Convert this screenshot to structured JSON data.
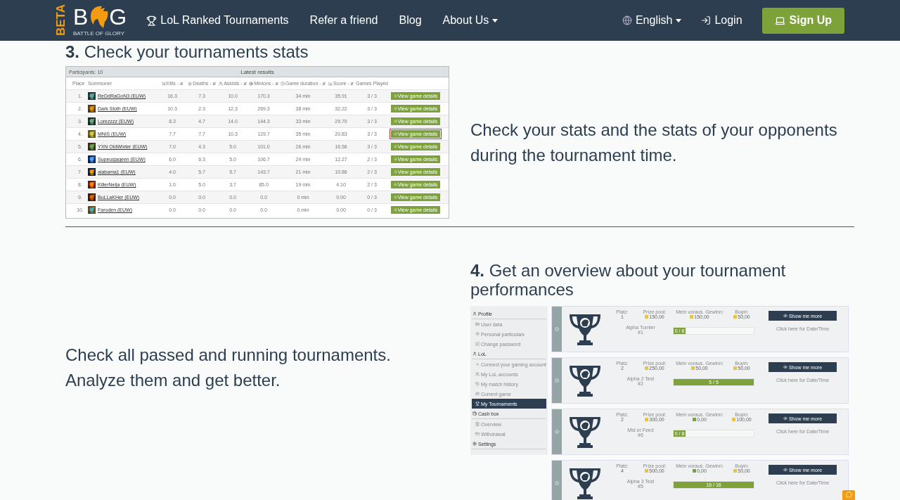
{
  "header": {
    "beta": "BETA",
    "logo": {
      "left": "B",
      "right": "G",
      "tagline": "BATTLE OF GLORY"
    },
    "nav": [
      {
        "label": "LoL Ranked Tournaments",
        "kind": "trophy"
      },
      {
        "label": "Refer a friend",
        "kind": "plain"
      },
      {
        "label": "Blog",
        "kind": "plain"
      },
      {
        "label": "About Us",
        "kind": "dropdown"
      }
    ],
    "language": "English",
    "login": "Login",
    "signup": "Sign Up"
  },
  "section3": {
    "number": "3.",
    "title": "Check your tournaments stats",
    "text": "Check your stats and the stats of your opponents during the tournament time.",
    "table": {
      "participants": "Participants: 10",
      "title": "Latest results",
      "columns": [
        "Place",
        "Summoner",
        "Kills - ø",
        "Deaths - ø",
        "Assists - ø",
        "Minions - ø",
        "Game duration - ø",
        "Score - ø",
        "Games Played"
      ],
      "rows": [
        {
          "place": "1.",
          "name": "ReDdRaGoN3",
          "region": "(EUW)",
          "kills": "16.3",
          "deaths": "7.3",
          "assists": "10.0",
          "minions": "170.3",
          "duration": "34 min",
          "score": "35.91",
          "played": "3 / 3",
          "button": "View game details",
          "highlighted": false
        },
        {
          "place": "2.",
          "name": "Dark Sloth",
          "region": "(EUW)",
          "kills": "10.3",
          "deaths": "2.3",
          "assists": "12.3",
          "minions": "269.3",
          "duration": "38 min",
          "score": "32.22",
          "played": "3 / 3",
          "button": "View game details",
          "highlighted": false
        },
        {
          "place": "3.",
          "name": "Lorezzzz",
          "region": "(EUW)",
          "kills": "8.3",
          "deaths": "4.7",
          "assists": "14.0",
          "minions": "144.3",
          "duration": "33 min",
          "score": "29.70",
          "played": "3 / 3",
          "button": "View game details",
          "highlighted": false
        },
        {
          "place": "4.",
          "name": "MNiS",
          "region": "(EUW)",
          "kills": "7.7",
          "deaths": "7.7",
          "assists": "10.3",
          "minions": "129.7",
          "duration": "35 min",
          "score": "20.83",
          "played": "3 / 3",
          "button": "View game details",
          "highlighted": true
        },
        {
          "place": "5.",
          "name": "YXN OldWinter",
          "region": "(EUW)",
          "kills": "7.0",
          "deaths": "4.3",
          "assists": "5.0",
          "minions": "101.0",
          "duration": "26 min",
          "score": "16.56",
          "played": "3 / 3",
          "button": "View game details",
          "highlighted": false
        },
        {
          "place": "6.",
          "name": "Supeusjageen",
          "region": "(EUW)",
          "kills": "6.0",
          "deaths": "6.3",
          "assists": "5.0",
          "minions": "106.7",
          "duration": "24 min",
          "score": "12.27",
          "played": "2 / 3",
          "button": "View game details",
          "highlighted": false
        },
        {
          "place": "7.",
          "name": "alabama1",
          "region": "(EUW)",
          "kills": "4.0",
          "deaths": "5.7",
          "assists": "5.7",
          "minions": "143.7",
          "duration": "21 min",
          "score": "10.86",
          "played": "2 / 3",
          "button": "View game details",
          "highlighted": false
        },
        {
          "place": "8.",
          "name": "KillerNeija",
          "region": "(EUW)",
          "kills": "1.0",
          "deaths": "5.0",
          "assists": "3.7",
          "minions": "85.0",
          "duration": "19 min",
          "score": "4.10",
          "played": "2 / 3",
          "button": "View game details",
          "highlighted": false
        },
        {
          "place": "9.",
          "name": "BuLLaKHer",
          "region": "(EUW)",
          "kills": "0.0",
          "deaths": "0.0",
          "assists": "0.0",
          "minions": "0.0",
          "duration": "0 min",
          "score": "0.00",
          "played": "0 / 3",
          "button": "View game details",
          "highlighted": false
        },
        {
          "place": "10.",
          "name": "Faroden",
          "region": "(EUW)",
          "kills": "0.0",
          "deaths": "0.0",
          "assists": "0.0",
          "minions": "0.0",
          "duration": "0 min",
          "score": "0.00",
          "played": "0 / 3",
          "button": "View game details",
          "highlighted": false
        }
      ]
    }
  },
  "section4": {
    "number": "4.",
    "title": "Get an overview about your tournament performances",
    "text": "Check all passed and running tournaments. Analyze them and get better.",
    "sidebar": [
      {
        "label": "Profile",
        "kind": "header",
        "selected": false
      },
      {
        "label": "User data",
        "kind": "item",
        "selected": false
      },
      {
        "label": "Personal particulars",
        "kind": "item",
        "selected": false
      },
      {
        "label": "Change password",
        "kind": "item",
        "selected": false
      },
      {
        "label": "LoL",
        "kind": "header",
        "selected": false
      },
      {
        "label": "Connect your gaming account",
        "kind": "item",
        "selected": false
      },
      {
        "label": "My LoL accounts",
        "kind": "item",
        "selected": false
      },
      {
        "label": "My match history",
        "kind": "item",
        "selected": false
      },
      {
        "label": "Current game",
        "kind": "item",
        "selected": false
      },
      {
        "label": "My Tournaments",
        "kind": "item",
        "selected": true
      },
      {
        "label": "Cash box",
        "kind": "header",
        "selected": false
      },
      {
        "label": "Overview",
        "kind": "item",
        "selected": false
      },
      {
        "label": "Withdrawal",
        "kind": "item",
        "selected": false
      },
      {
        "label": "Settings",
        "kind": "header",
        "selected": false
      }
    ],
    "cards": [
      {
        "place_label": "Platz:",
        "place": "1",
        "prize_label": "Prize pool:",
        "prize": {
          "value": "150,00",
          "kind": "coin"
        },
        "win_label": "Mein voraus. Gewinn:",
        "win": {
          "value": "150,00",
          "kind": "coin"
        },
        "buyin_label": "Buyin:",
        "buyin": {
          "value": "50,00",
          "kind": "coin"
        },
        "name": "Alpha Turnier",
        "number": "#1",
        "progress": "0 / 8",
        "level": 0.15,
        "button": "Show me more",
        "date": "Click here for Date/Time"
      },
      {
        "place_label": "Platz:",
        "place": "2",
        "prize_label": "Prize pool:",
        "prize": {
          "value": "250,00",
          "kind": "coin"
        },
        "win_label": "Mein voraus. Gewinn:",
        "win": {
          "value": "50,00",
          "kind": "coin"
        },
        "buyin_label": "Buyin:",
        "buyin": {
          "value": "50,00",
          "kind": "coin"
        },
        "name": "Alpha 2 Test",
        "number": "#2",
        "progress": "5 / 5",
        "level": 1,
        "button": "Show me more",
        "date": "Click here for Date/Time"
      },
      {
        "place_label": "Platz:",
        "place": "2",
        "prize_label": "Prize pool:",
        "prize": {
          "value": "300,00",
          "kind": "coin"
        },
        "win_label": "Mein voraus. Gewinn:",
        "win": {
          "value": "0,00",
          "kind": "cash"
        },
        "buyin_label": "Buyin:",
        "buyin": {
          "value": "100,00",
          "kind": "coin"
        },
        "name": "Mid or Feed",
        "number": "#6",
        "progress": "0 / 8",
        "level": 0.15,
        "button": "Show me more",
        "date": "Click here for Date/Time"
      },
      {
        "place_label": "Platz:",
        "place": "4",
        "prize_label": "Prize pool:",
        "prize": {
          "value": "500,00",
          "kind": "coin"
        },
        "win_label": "Mein voraus. Gewinn:",
        "win": {
          "value": "0,00",
          "kind": "cash"
        },
        "buyin_label": "Buyin:",
        "buyin": {
          "value": "50,00",
          "kind": "coin"
        },
        "name": "Alpha 3 Test",
        "number": "#5",
        "progress": "16 / 16",
        "level": 1,
        "button": "Show me more",
        "date": "Click here for Date/Time"
      }
    ]
  }
}
